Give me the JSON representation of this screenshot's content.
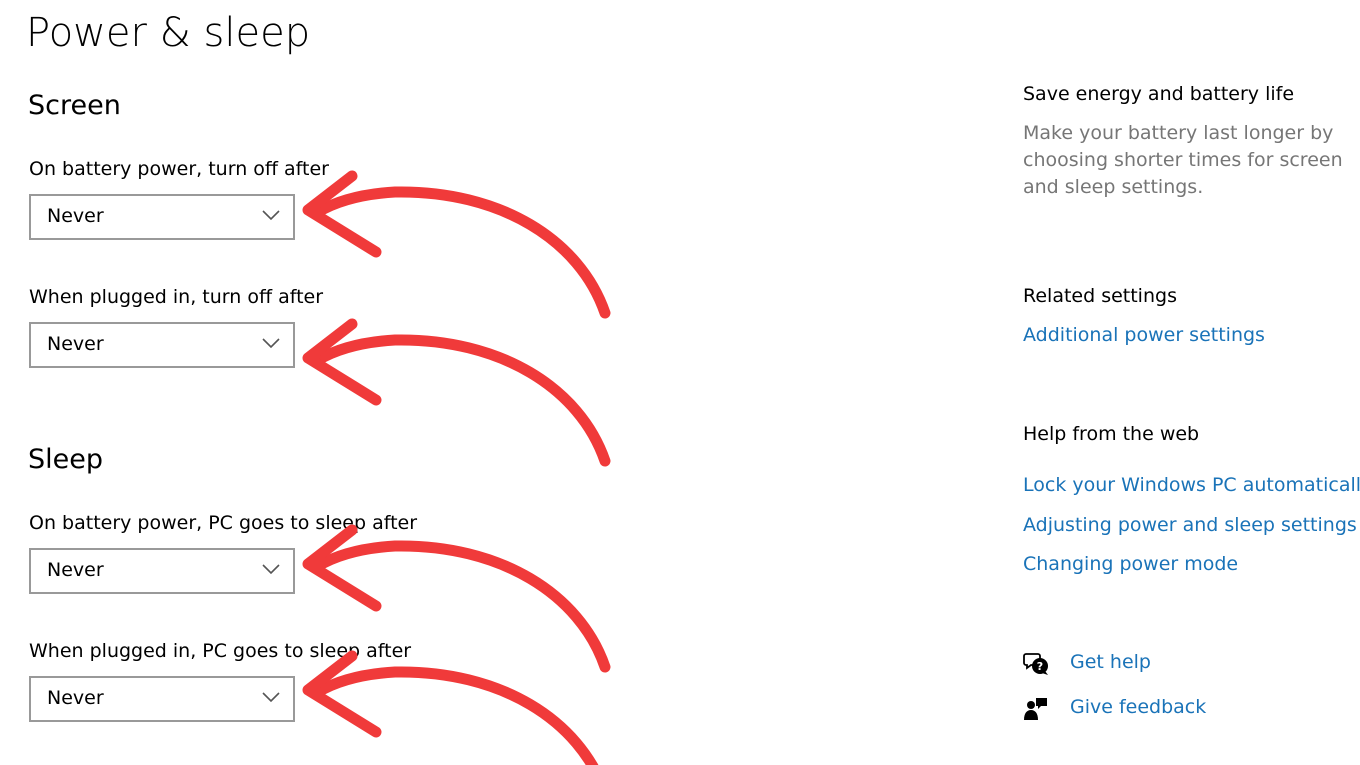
{
  "page": {
    "title": "Power & sleep"
  },
  "screen": {
    "heading": "Screen",
    "battery_label": "On battery power, turn off after",
    "battery_value": "Never",
    "plugged_label": "When plugged in, turn off after",
    "plugged_value": "Never"
  },
  "sleep": {
    "heading": "Sleep",
    "battery_label": "On battery power, PC goes to sleep after",
    "battery_value": "Never",
    "plugged_label": "When plugged in, PC goes to sleep after",
    "plugged_value": "Never"
  },
  "sidebar": {
    "save_energy": {
      "heading": "Save energy and battery life",
      "text": "Make your battery last longer by choosing shorter times for screen and sleep settings."
    },
    "related": {
      "heading": "Related settings",
      "link": "Additional power settings"
    },
    "help_web": {
      "heading": "Help from the web",
      "links": [
        "Lock your Windows PC automatically",
        "Adjusting power and sleep settings",
        "Changing power mode"
      ]
    },
    "get_help": "Get help",
    "give_feedback": "Give feedback"
  },
  "colors": {
    "link": "#1a73b8",
    "secondary_text": "#767676",
    "dropdown_border": "#999999",
    "annotation_arrow": "#f03a3a"
  },
  "icons": {
    "dropdown": "chevron-down-icon",
    "help": "help-chat-icon",
    "feedback": "feedback-person-icon",
    "annotation": "curved-arrow-icon"
  }
}
